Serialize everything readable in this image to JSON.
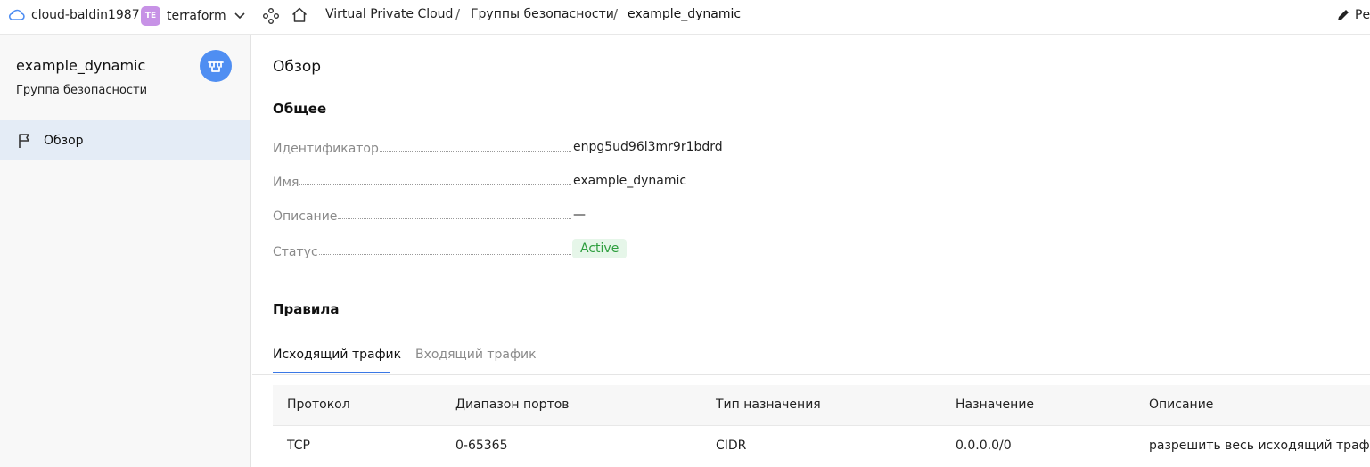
{
  "topbar": {
    "cloud_name": "cloud-baldin1987",
    "folder_badge": "TE",
    "folder_name": "terraform",
    "breadcrumbs": [
      "Virtual Private Cloud",
      "Группы безопасности",
      "example_dynamic"
    ],
    "separator": "/",
    "edit_label": "Ре"
  },
  "sidebar": {
    "title": "example_dynamic",
    "subtitle": "Группа безопасности",
    "items": [
      {
        "label": "Обзор",
        "icon": "flag-icon"
      }
    ]
  },
  "main": {
    "page_title": "Обзор",
    "general_title": "Общее",
    "properties": [
      {
        "key": "Идентификатор",
        "value": "enpg5ud96l3mr9r1bdrd"
      },
      {
        "key": "Имя",
        "value": "example_dynamic"
      },
      {
        "key": "Описание",
        "value": "—"
      },
      {
        "key": "Статус",
        "value": "Active"
      }
    ],
    "rules_title": "Правила",
    "tabs": [
      {
        "label": "Исходящий трафик",
        "active": true
      },
      {
        "label": "Входящий трафик",
        "active": false
      }
    ],
    "table": {
      "columns": [
        "Протокол",
        "Диапазон портов",
        "Тип назначения",
        "Назначение",
        "Описание"
      ],
      "rows": [
        [
          "TCP",
          "0-65365",
          "CIDR",
          "0.0.0.0/0",
          "разрешить весь исходящий трафик"
        ]
      ]
    }
  },
  "colors": {
    "accent": "#3a78e6",
    "status_green": "#2e9e3e",
    "status_bg": "#e6f6e9",
    "folder_badge": "#c792e6",
    "avatar": "#4f8ef2",
    "nav_active_bg": "#e4ecf6"
  }
}
